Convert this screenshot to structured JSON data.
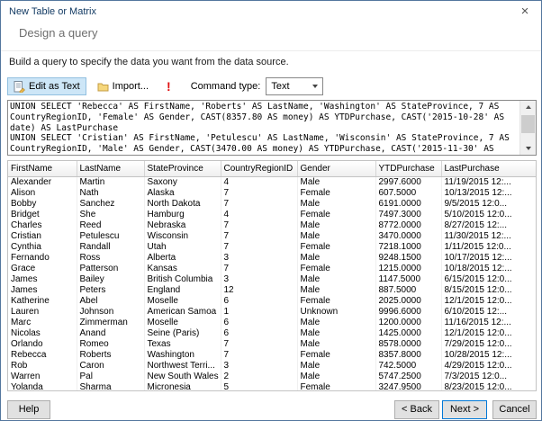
{
  "window": {
    "title": "New Table or Matrix"
  },
  "icons": {
    "close": "×",
    "run_query": "!"
  },
  "wizard": {
    "step_title": "Design a query",
    "description": "Build a query to specify the data you want from the data source."
  },
  "toolbar": {
    "edit_as_text": "Edit as Text",
    "import": "Import...",
    "command_type_label": "Command type:",
    "command_type_value": "Text"
  },
  "query": {
    "text": "UNION SELECT 'Rebecca' AS FirstName, 'Roberts' AS LastName, 'Washington' AS StateProvince, 7 AS CountryRegionID, 'Female' AS Gender, CAST(8357.80 AS money) AS YTDPurchase, CAST('2015-10-28' AS date) AS LastPurchase\nUNION SELECT 'Cristian' AS FirstName, 'Petulescu' AS LastName, 'Wisconsin' AS StateProvince, 7 AS CountryRegionID, 'Male' AS Gender, CAST(3470.00 AS money) AS YTDPurchase, CAST('2015-11-30' AS date) AS"
  },
  "grid": {
    "columns": [
      "FirstName",
      "LastName",
      "StateProvince",
      "CountryRegionID",
      "Gender",
      "YTDPurchase",
      "LastPurchase"
    ],
    "rows": [
      [
        "Alexander",
        "Martin",
        "Saxony",
        "4",
        "Male",
        "2997.6000",
        "11/19/2015 12:..."
      ],
      [
        "Alison",
        "Nath",
        "Alaska",
        "7",
        "Female",
        "607.5000",
        "10/13/2015 12:..."
      ],
      [
        "Bobby",
        "Sanchez",
        "North Dakota",
        "7",
        "Male",
        "6191.0000",
        "9/5/2015 12:0..."
      ],
      [
        "Bridget",
        "She",
        "Hamburg",
        "4",
        "Female",
        "7497.3000",
        "5/10/2015 12:0..."
      ],
      [
        "Charles",
        "Reed",
        "Nebraska",
        "7",
        "Male",
        "8772.0000",
        "8/27/2015 12:..."
      ],
      [
        "Cristian",
        "Petulescu",
        "Wisconsin",
        "7",
        "Male",
        "3470.0000",
        "11/30/2015 12:..."
      ],
      [
        "Cynthia",
        "Randall",
        "Utah",
        "7",
        "Female",
        "7218.1000",
        "1/11/2015 12:0..."
      ],
      [
        "Fernando",
        "Ross",
        "Alberta",
        "3",
        "Male",
        "9248.1500",
        "10/17/2015 12:..."
      ],
      [
        "Grace",
        "Patterson",
        "Kansas",
        "7",
        "Female",
        "1215.0000",
        "10/18/2015 12:..."
      ],
      [
        "James",
        "Bailey",
        "British Columbia",
        "3",
        "Male",
        "1147.5000",
        "6/15/2015 12:0..."
      ],
      [
        "James",
        "Peters",
        "England",
        "12",
        "Male",
        "887.5000",
        "8/15/2015 12:0..."
      ],
      [
        "Katherine",
        "Abel",
        "Moselle",
        "6",
        "Female",
        "2025.0000",
        "12/1/2015 12:0..."
      ],
      [
        "Lauren",
        "Johnson",
        "American Samoa",
        "1",
        "Unknown",
        "9996.6000",
        "6/10/2015 12:..."
      ],
      [
        "Marc",
        "Zimmerman",
        "Moselle",
        "6",
        "Male",
        "1200.0000",
        "11/16/2015 12:..."
      ],
      [
        "Nicolas",
        "Anand",
        "Seine (Paris)",
        "6",
        "Male",
        "1425.0000",
        "12/1/2015 12:0..."
      ],
      [
        "Orlando",
        "Romeo",
        "Texas",
        "7",
        "Male",
        "8578.0000",
        "7/29/2015 12:0..."
      ],
      [
        "Rebecca",
        "Roberts",
        "Washington",
        "7",
        "Female",
        "8357.8000",
        "10/28/2015 12:..."
      ],
      [
        "Rob",
        "Caron",
        "Northwest Terri...",
        "3",
        "Male",
        "742.5000",
        "4/29/2015 12:0..."
      ],
      [
        "Warren",
        "Pal",
        "New South Wales",
        "2",
        "Male",
        "5747.2500",
        "7/3/2015 12:0..."
      ],
      [
        "Yolanda",
        "Sharma",
        "Micronesia",
        "5",
        "Female",
        "3247.9500",
        "8/23/2015 12:0..."
      ]
    ]
  },
  "footer": {
    "help": "Help",
    "back": "< Back",
    "next": "Next >",
    "cancel": "Cancel"
  },
  "colors": {
    "dialog_border": "#54779e",
    "accent_default_button": "#0078d7",
    "toolbar_toggle_bg": "#cde6f7",
    "toolbar_toggle_border": "#92c0e0",
    "run_icon_red": "#e01010",
    "title_text": "#123a63"
  }
}
